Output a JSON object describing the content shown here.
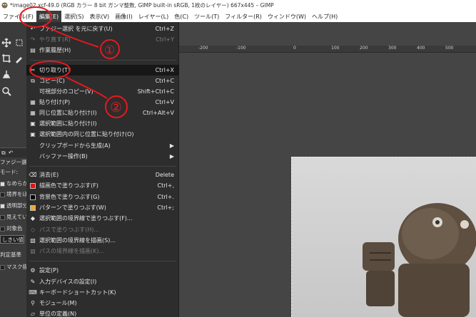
{
  "window": {
    "title": "*image02.xcf-49.0 (RGB カラー 8 bit ガンマ整数, GIMP built-in sRGB, 1枚のレイヤー) 667x445 – GIMP"
  },
  "menubar": [
    {
      "label": "ファイル(F)"
    },
    {
      "label": "編集(E)"
    },
    {
      "label": "選択(S)"
    },
    {
      "label": "表示(V)"
    },
    {
      "label": "画像(I)"
    },
    {
      "label": "レイヤー(L)"
    },
    {
      "label": "色(C)"
    },
    {
      "label": "ツール(T)"
    },
    {
      "label": "フィルター(R)"
    },
    {
      "label": "ウィンドウ(W)"
    },
    {
      "label": "ヘルプ(H)"
    }
  ],
  "edit_menu": [
    {
      "label": "ファジー選択 を元に戻す(U)",
      "shortcut": "Ctrl+Z",
      "icon": "undo-icon"
    },
    {
      "label": "やり直す(R)",
      "shortcut": "Ctrl+Y",
      "icon": "redo-icon"
    },
    {
      "label": "作業履歴(H)",
      "shortcut": "",
      "icon": "history-icon"
    },
    {
      "label": "切り取り(T)",
      "shortcut": "Ctrl+X",
      "icon": "scissors-icon"
    },
    {
      "label": "コピー(C)",
      "shortcut": "Ctrl+C",
      "icon": "copy-icon"
    },
    {
      "label": "可視部分のコピー(V)",
      "shortcut": "Shift+Ctrl+C",
      "icon": ""
    },
    {
      "label": "貼り付け(P)",
      "shortcut": "Ctrl+V",
      "icon": "paste-icon"
    },
    {
      "label": "同じ位置に貼り付け(I)",
      "shortcut": "Ctrl+Alt+V",
      "icon": "paste-in-place-icon"
    },
    {
      "label": "選択範囲に貼り付け(I)",
      "shortcut": "",
      "icon": "paste-into-icon"
    },
    {
      "label": "選択範囲内の同じ位置に貼り付け(O)",
      "shortcut": "",
      "icon": "paste-into-in-place-icon"
    },
    {
      "label": "クリップボードから生成(A)",
      "shortcut": "",
      "icon": "",
      "submenu": "▶"
    },
    {
      "label": "バッファー操作(B)",
      "shortcut": "",
      "icon": "",
      "submenu": "▶"
    },
    {
      "label": "消去(E)",
      "shortcut": "Delete",
      "icon": "clear-icon"
    },
    {
      "label": "描画色で塗りつぶす(F)",
      "shortcut": "Ctrl+,",
      "icon": "fg-swatch-icon"
    },
    {
      "label": "背景色で塗りつぶす(G)",
      "shortcut": "Ctrl+.",
      "icon": "bg-swatch-icon"
    },
    {
      "label": "パターンで塗りつぶす(W)",
      "shortcut": "Ctrl+;",
      "icon": "pattern-icon"
    },
    {
      "label": "選択範囲の境界線で塗りつぶす(F)...",
      "shortcut": "",
      "icon": "stroke-fill-icon"
    },
    {
      "label": "パスで塗りつぶす(H)...",
      "shortcut": "",
      "icon": "path-fill-icon"
    },
    {
      "label": "選択範囲の境界線を描画(S)...",
      "shortcut": "",
      "icon": "stroke-selection-icon"
    },
    {
      "label": "パスの境界線を描画(K)...",
      "shortcut": "",
      "icon": "stroke-path-icon"
    },
    {
      "label": "設定(P)",
      "shortcut": "",
      "icon": "preferences-icon"
    },
    {
      "label": "入力デバイスの設定(I)",
      "shortcut": "",
      "icon": "input-devices-icon"
    },
    {
      "label": "キーボードショートカット(K)",
      "shortcut": "",
      "icon": "keyboard-icon"
    },
    {
      "label": "モジュール(M)",
      "shortcut": "",
      "icon": "modules-icon"
    },
    {
      "label": "単位の定義(N)",
      "shortcut": "",
      "icon": "units-icon"
    }
  ],
  "toolbox": {
    "panel_title": "ファジー選",
    "mode_label": "モード:",
    "options": [
      {
        "label": "なめらか"
      },
      {
        "label": "境界をぼ"
      },
      {
        "label": "透明部分"
      },
      {
        "label": "見えてい"
      },
      {
        "label": "対象色"
      }
    ],
    "threshold_label": "しきい値",
    "criterion_label": "判定基準",
    "mask_label": "マスク描"
  },
  "ruler": {
    "ticks": [
      "-200",
      "-100",
      "0",
      "100",
      "200",
      "300",
      "400",
      "500"
    ]
  },
  "annotations": [
    {
      "label": "①"
    },
    {
      "label": "②"
    }
  ],
  "colors": {
    "annotation_red": "#e6191e",
    "menu_bg": "#2d2d2d",
    "menu_highlight": "#171717",
    "fg_swatch": "#e81010",
    "bg_swatch": "#000000",
    "pattern_swatch": "#f0a830"
  }
}
